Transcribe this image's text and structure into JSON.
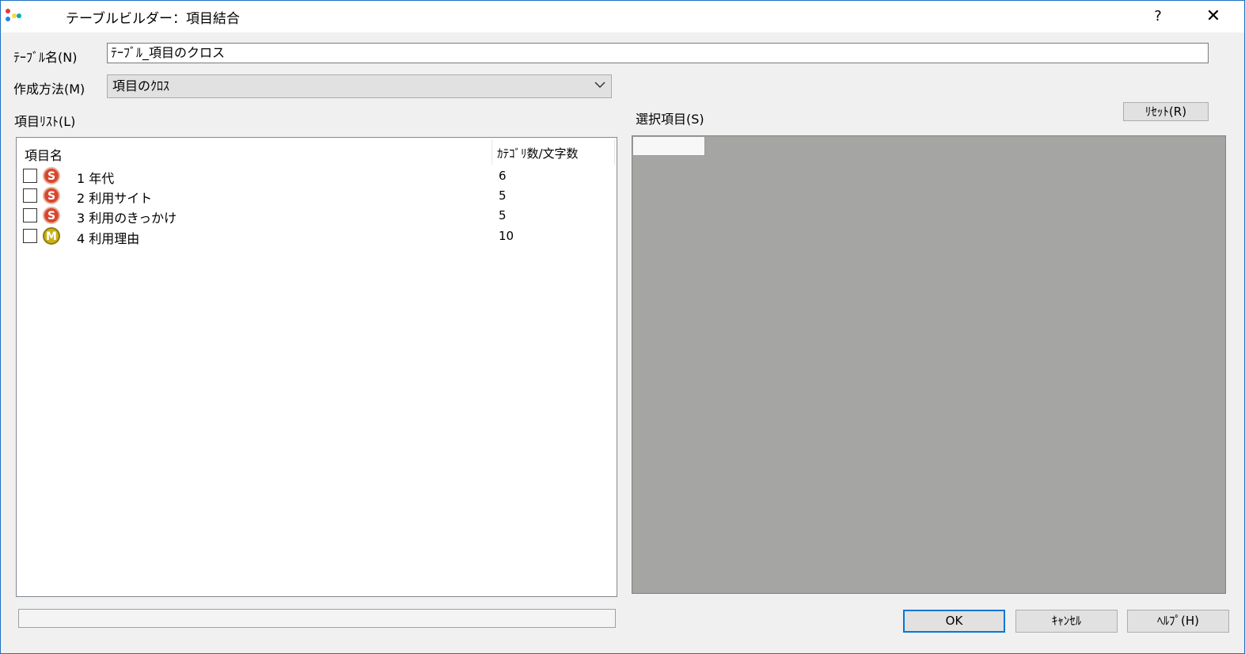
{
  "window": {
    "title": "テーブルビルダー：項目結合",
    "help_label": "?",
    "close_label": "✕"
  },
  "form": {
    "table_name_label": "ﾃｰﾌﾞﾙ名(N)",
    "table_name_value": "ﾃｰﾌﾞﾙ_項目のクロス",
    "method_label": "作成方法(M)",
    "method_value": "項目のｸﾛｽ"
  },
  "item_list": {
    "label": "項目ﾘｽﾄ(L)",
    "columns": [
      "項目名",
      "ｶﾃｺﾞﾘ数/文字数"
    ],
    "rows": [
      {
        "checked": false,
        "type": "S",
        "name": "1 年代",
        "count": "6"
      },
      {
        "checked": false,
        "type": "S",
        "name": "2 利用サイト",
        "count": "5"
      },
      {
        "checked": false,
        "type": "S",
        "name": "3 利用のきっかけ",
        "count": "5"
      },
      {
        "checked": false,
        "type": "M",
        "name": "4 利用理由",
        "count": "10"
      }
    ]
  },
  "selected": {
    "label": "選択項目(S)",
    "reset_label": "ﾘｾｯﾄ(R)"
  },
  "buttons": {
    "ok": "OK",
    "cancel": "ｷｬﾝｾﾙ",
    "help": "ﾍﾙﾌﾟ(H)"
  },
  "colors": {
    "accent": "#0078d7",
    "single_badge": "#d7472f",
    "multi_badge": "#c9b21a",
    "selection_bg": "#a5a6a4"
  }
}
